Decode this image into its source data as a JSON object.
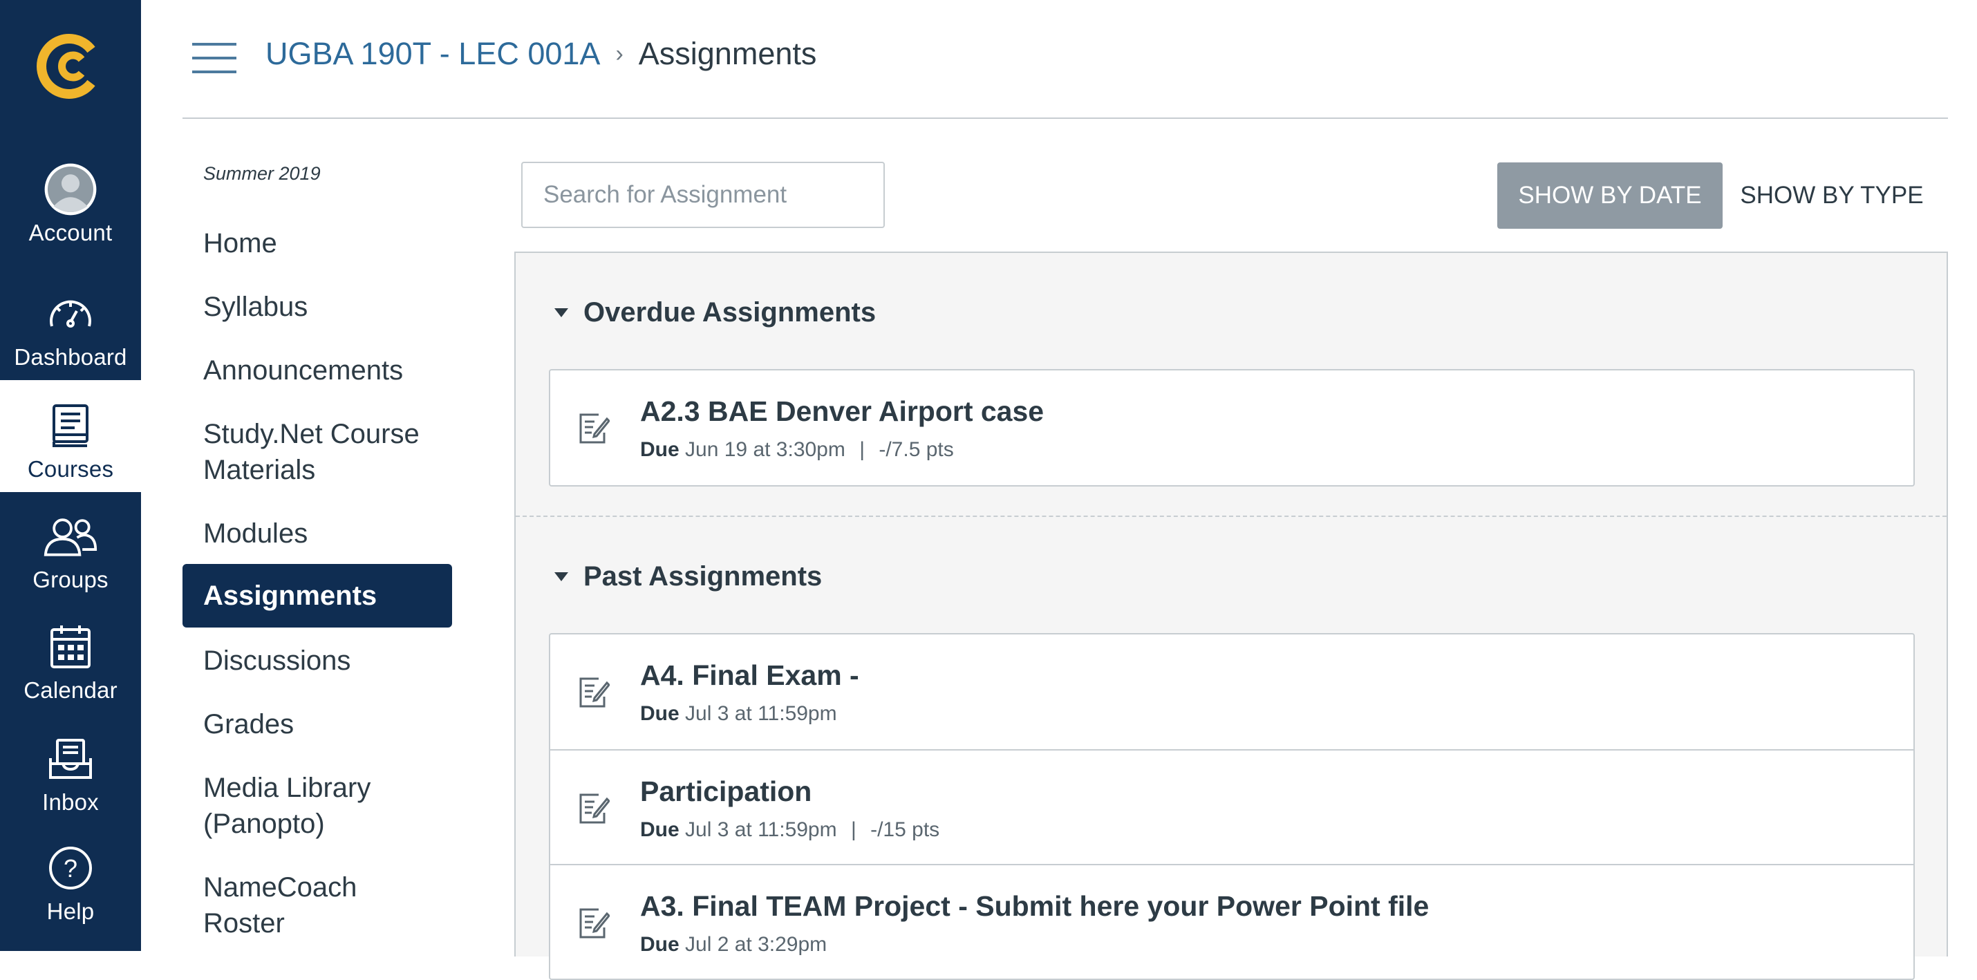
{
  "global_nav": {
    "items": [
      {
        "label": "Account",
        "icon": "avatar-icon"
      },
      {
        "label": "Dashboard",
        "icon": "dashboard-icon"
      },
      {
        "label": "Courses",
        "icon": "courses-icon",
        "active": true
      },
      {
        "label": "Groups",
        "icon": "groups-icon"
      },
      {
        "label": "Calendar",
        "icon": "calendar-icon"
      },
      {
        "label": "Inbox",
        "icon": "inbox-icon"
      },
      {
        "label": "Help",
        "icon": "help-icon"
      }
    ],
    "colors": {
      "background": "#0f2d52",
      "logo": "#f0b52c"
    }
  },
  "header": {
    "course": "UGBA 190T - LEC 001A",
    "separator": "›",
    "current": "Assignments"
  },
  "course_nav": {
    "term": "Summer 2019",
    "items": [
      {
        "label": "Home"
      },
      {
        "label": "Syllabus"
      },
      {
        "label": "Announcements"
      },
      {
        "label": "Study.Net Course Materials"
      },
      {
        "label": "Modules"
      },
      {
        "label": "Assignments",
        "active": true
      },
      {
        "label": "Discussions"
      },
      {
        "label": "Grades"
      },
      {
        "label": "Media Library (Panopto)"
      },
      {
        "label": "NameCoach Roster"
      }
    ]
  },
  "toolbar": {
    "search_placeholder": "Search for Assignment",
    "search_value": "",
    "show_by_date": "SHOW BY DATE",
    "show_by_type": "SHOW BY TYPE"
  },
  "groups": {
    "overdue": {
      "title": "Overdue Assignments",
      "items": [
        {
          "title": "A2.3 BAE Denver Airport case",
          "due_label": "Due",
          "due": "Jun 19 at 3:30pm",
          "points": "-/7.5 pts"
        }
      ]
    },
    "past": {
      "title": "Past Assignments",
      "items": [
        {
          "title": "A4. Final Exam -",
          "due_label": "Due",
          "due": "Jul 3 at 11:59pm"
        },
        {
          "title": "Participation",
          "due_label": "Due",
          "due": "Jul 3 at 11:59pm",
          "points": "-/15 pts"
        },
        {
          "title": "A3. Final TEAM Project - Submit here your Power Point file",
          "due_label": "Due",
          "due": "Jul 2 at 3:29pm"
        }
      ]
    }
  }
}
